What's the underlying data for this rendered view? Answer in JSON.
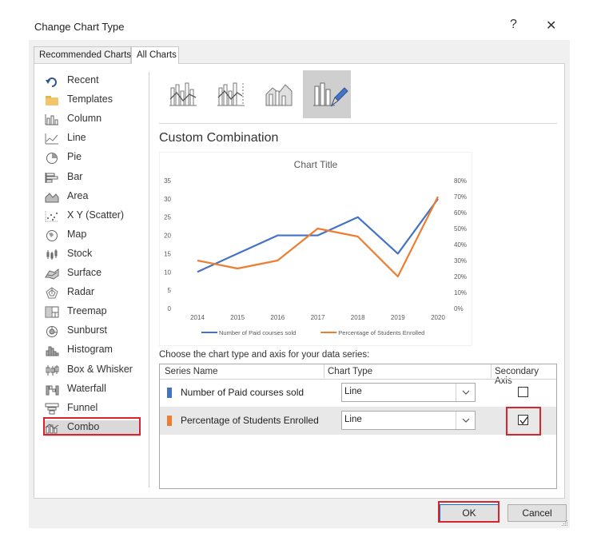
{
  "window": {
    "title": "Change Chart Type",
    "help_label": "?",
    "close_label": "✕"
  },
  "tabs": [
    {
      "label": "Recommended Charts"
    },
    {
      "label": "All Charts"
    }
  ],
  "categories": [
    {
      "label": "Recent",
      "icon": "recent-icon"
    },
    {
      "label": "Templates",
      "icon": "folder-icon"
    },
    {
      "label": "Column",
      "icon": "column-chart-icon"
    },
    {
      "label": "Line",
      "icon": "line-chart-icon"
    },
    {
      "label": "Pie",
      "icon": "pie-chart-icon"
    },
    {
      "label": "Bar",
      "icon": "bar-chart-icon"
    },
    {
      "label": "Area",
      "icon": "area-chart-icon"
    },
    {
      "label": "X Y (Scatter)",
      "icon": "scatter-chart-icon"
    },
    {
      "label": "Map",
      "icon": "map-chart-icon"
    },
    {
      "label": "Stock",
      "icon": "stock-chart-icon"
    },
    {
      "label": "Surface",
      "icon": "surface-chart-icon"
    },
    {
      "label": "Radar",
      "icon": "radar-chart-icon"
    },
    {
      "label": "Treemap",
      "icon": "treemap-chart-icon"
    },
    {
      "label": "Sunburst",
      "icon": "sunburst-chart-icon"
    },
    {
      "label": "Histogram",
      "icon": "histogram-chart-icon"
    },
    {
      "label": "Box & Whisker",
      "icon": "box-whisker-chart-icon"
    },
    {
      "label": "Waterfall",
      "icon": "waterfall-chart-icon"
    },
    {
      "label": "Funnel",
      "icon": "funnel-chart-icon"
    },
    {
      "label": "Combo",
      "icon": "combo-chart-icon"
    }
  ],
  "selected_category": "Combo",
  "subtypes": [
    {
      "icon": "clustered-column-line-icon"
    },
    {
      "icon": "clustered-column-line-secondary-axis-icon"
    },
    {
      "icon": "stacked-area-clustered-column-icon"
    },
    {
      "icon": "custom-combination-icon"
    }
  ],
  "section_title": "Custom Combination",
  "chart_data": {
    "type": "line",
    "title": "Chart Title",
    "categories": [
      "2014",
      "2015",
      "2016",
      "2017",
      "2018",
      "2019",
      "2020"
    ],
    "series": [
      {
        "name": "Number of Paid courses sold",
        "values": [
          10,
          15,
          20,
          20,
          25,
          15,
          30
        ],
        "axis": "primary",
        "color": "#4472c4"
      },
      {
        "name": "Percentage of Students Enrolled",
        "values": [
          30,
          25,
          30,
          50,
          45,
          20,
          70
        ],
        "axis": "secondary",
        "unit": "%",
        "color": "#ed7d31"
      }
    ],
    "y_ticks": [
      "0",
      "5",
      "10",
      "15",
      "20",
      "25",
      "30",
      "35"
    ],
    "y2_ticks": [
      "0%",
      "10%",
      "20%",
      "30%",
      "40%",
      "50%",
      "60%",
      "70%",
      "80%"
    ],
    "ylim": [
      0,
      35
    ],
    "y2lim": [
      0,
      80
    ],
    "grid": false,
    "legend": "bottom"
  },
  "series_table": {
    "label": "Choose the chart type and axis for your data series:",
    "headers": {
      "name": "Series Name",
      "type": "Chart Type",
      "axis": "Secondary Axis"
    },
    "rows": [
      {
        "name": "Number of Paid courses sold",
        "chart_type": "Line",
        "secondary_axis": false,
        "color": "#4472c4"
      },
      {
        "name": "Percentage of Students Enrolled",
        "chart_type": "Line",
        "secondary_axis": true,
        "color": "#ed7d31"
      }
    ]
  },
  "buttons": {
    "ok": "OK",
    "cancel": "Cancel"
  }
}
